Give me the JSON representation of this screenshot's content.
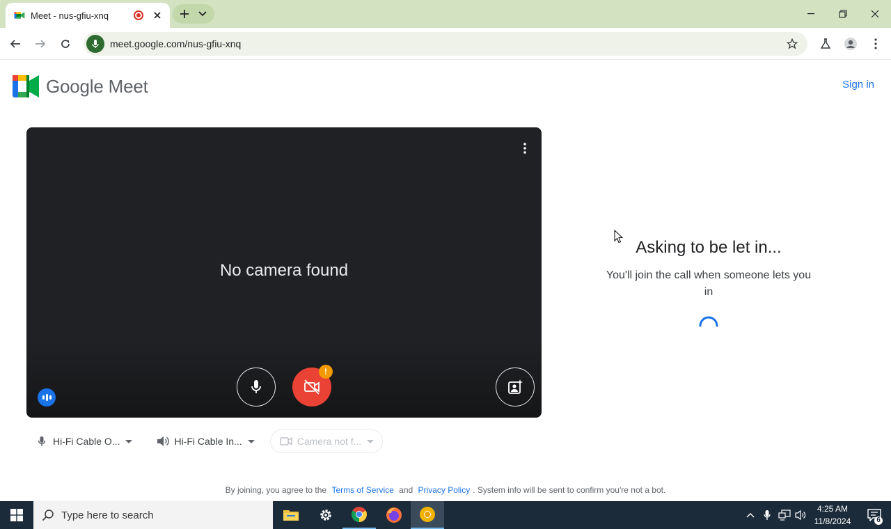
{
  "browser": {
    "tab_title": "Meet - nus-gfiu-xnq",
    "url": "meet.google.com/nus-gfiu-xnq"
  },
  "meet": {
    "brand": "Google Meet",
    "sign_in": "Sign in",
    "no_camera": "No camera found",
    "warning_mark": "!",
    "devices": {
      "mic": "Hi-Fi Cable O...",
      "speaker": "Hi-Fi Cable In...",
      "camera": "Camera not f..."
    },
    "waiting_title": "Asking to be let in...",
    "waiting_sub": "You'll join the call when someone lets you in",
    "legal": {
      "prefix": "By joining, you agree to the",
      "terms": "Terms of Service",
      "and": "and",
      "privacy": "Privacy Policy",
      "suffix": ". System info will be sent to confirm you're not a bot."
    }
  },
  "taskbar": {
    "search_placeholder": "Type here to search",
    "time": "4:25 AM",
    "date": "11/8/2024",
    "notifications": "6"
  },
  "colors": {
    "tabstrip": "#d3e3c1",
    "meet_blue": "#1a73e8",
    "camera_off_red": "#ea4335",
    "preview_bg": "#202124",
    "taskbar": "#1c2b3a"
  }
}
